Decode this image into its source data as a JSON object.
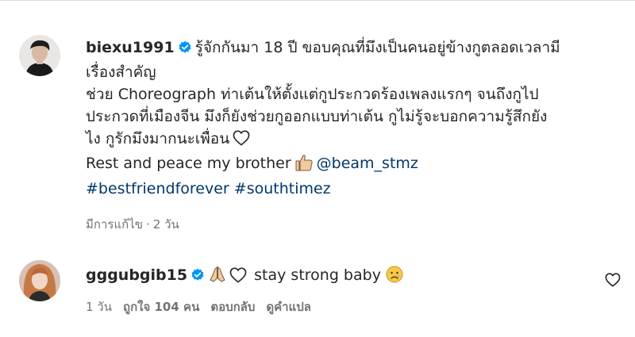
{
  "comments": [
    {
      "username": "biexu1991",
      "verified": true,
      "lines": [
        "รู้จักกันมา 18 ปี ขอบคุณที่มึงเป็นคนอยู่ข้างกูตลอดเวลามี",
        "เรื่องสำคัญ",
        "ช่วย Choreograph ท่าเต้นให้ตั้งแต่กูประกวดร้องเพลงแรกๆ จนถึงกูไป",
        "ประกวดที่เมืองจีน มึงก็ยังช่วยกูออกแบบท่าเต้น กูไม่รู้จะบอกความรู้สึกยัง",
        "ไง กูรักมึงมากนะเพื่อน"
      ],
      "rest_text": "Rest and peace my brother",
      "mention": "@beam_stmz",
      "hashtags": [
        "#bestfriendforever",
        "#southtimez"
      ],
      "edited_label": "มีการแก้ไข",
      "separator": "·",
      "time": "2 วัน"
    },
    {
      "username": "gggubgib15",
      "verified": true,
      "text": "stay strong baby",
      "time": "1 วัน",
      "likes_label": "ถูกใจ 104 คน",
      "reply_label": "ตอบกลับ",
      "translate_label": "ดูคำแปล"
    }
  ],
  "colors": {
    "link": "#00376b",
    "verified": "#0095f6",
    "meta": "#737373"
  },
  "icons": [
    "verified-badge-icon",
    "heart-outline-icon",
    "thumbs-up-emoji",
    "folded-hands-emoji",
    "sad-face-emoji"
  ]
}
